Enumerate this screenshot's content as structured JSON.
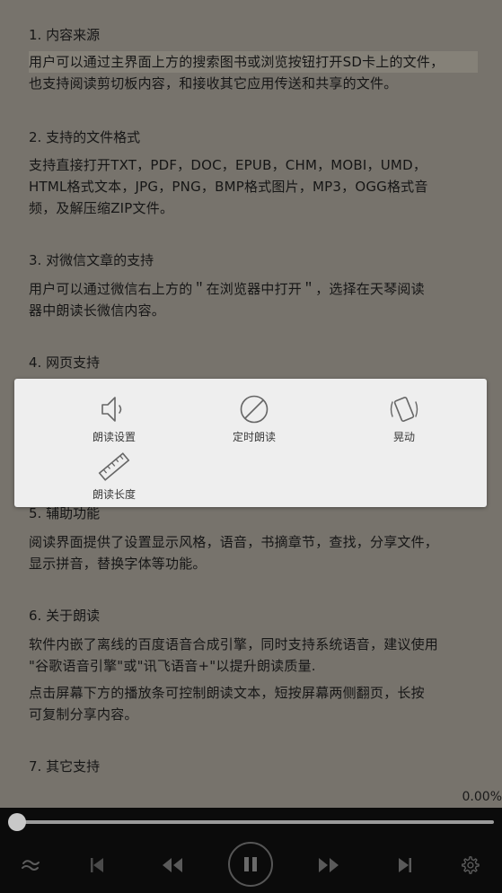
{
  "sections": [
    {
      "title": "1. 内容来源",
      "lines": [
        "用户可以通过主界面上方的搜索图书或浏览按钮打开SD卡上的文件，",
        "也支持阅读剪切板内容，和接收其它应用传送和共享的文件。"
      ]
    },
    {
      "title": "2. 支持的文件格式",
      "lines": [
        "支持直接打开TXT，PDF，DOC，EPUB，CHM，MOBI，UMD，",
        "HTML格式文本，JPG，PNG，BMP格式图片，MP3，OGG格式音",
        "频，及解压缩ZIP文件。"
      ]
    },
    {
      "title": "3. 对微信文章的支持",
      "lines": [
        "用户可以通过微信右上方的＂在浏览器中打开＂，选择在天琴阅读",
        "器中朗读长微信内容。"
      ]
    },
    {
      "title": "4. 网页支持",
      "lines": []
    },
    {
      "title": "5. 辅助功能",
      "lines": [
        "阅读界面提供了设置显示风格，语音，书摘章节，查找，分享文件，",
        "显示拼音，替换字体等功能。"
      ]
    },
    {
      "title": "6. 关于朗读",
      "lines": [
        "软件内嵌了离线的百度语音合成引擎，同时支持系统语音，建议使用",
        "\"谷歌语音引擎\"或\"讯飞语音+\"以提升朗读质量."
      ],
      "extra_lines": [
        "点击屏幕下方的播放条可控制朗读文本，短按屏幕两侧翻页，长按",
        "可复制分享内容。"
      ]
    },
    {
      "title": "7. 其它支持",
      "lines": []
    }
  ],
  "menu": {
    "read_settings": "朗读设置",
    "timer_read": "定时朗读",
    "shake": "晃动",
    "read_length": "朗读长度"
  },
  "progress": {
    "percent_text": "0.00%",
    "value": 0.0
  },
  "colors": {
    "page_bg": "#77736c",
    "player_bg": "#0b0b0b",
    "menu_bg": "#eeeeee"
  }
}
